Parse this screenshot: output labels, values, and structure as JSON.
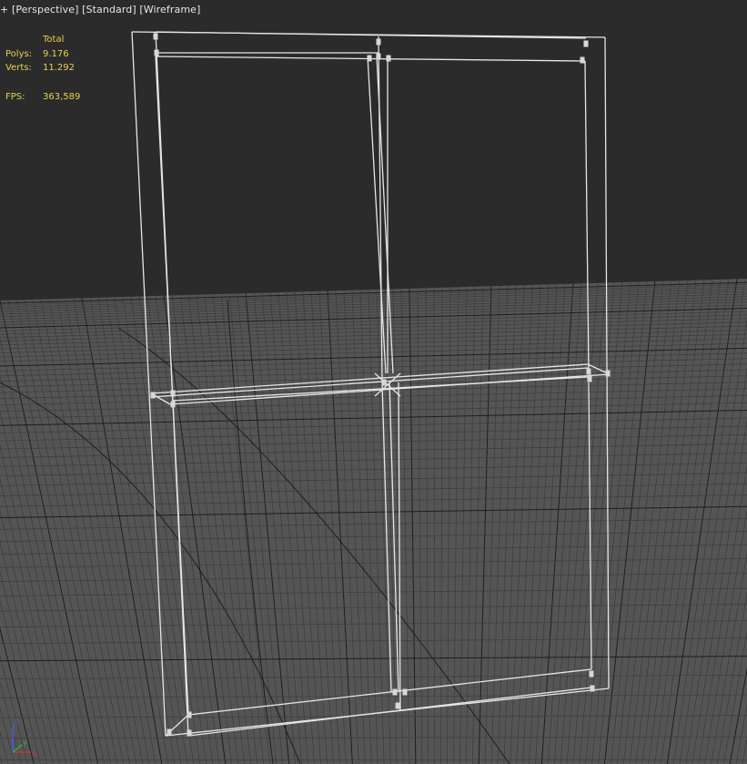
{
  "viewport": {
    "labels": [
      "+",
      "[Perspective]",
      "[Standard]",
      "[Wireframe]"
    ],
    "stats": {
      "header": "Total",
      "polys_label": "Polys:",
      "polys_value": "9.176",
      "verts_label": "Verts:",
      "verts_value": "11.292",
      "fps_label": "FPS:",
      "fps_value": "363,589"
    },
    "axis_gizmo": {
      "x": "x",
      "y": "y",
      "z": "z"
    }
  },
  "colors": {
    "background": "#2b2b2b",
    "floor": "#555555",
    "grid_line": "#3c3c3c",
    "grid_major": "#1e1e1e",
    "wire": "#e6e6e6",
    "stats_text": "#e8d24a",
    "axis_x": "#d03030",
    "axis_y": "#30b030",
    "axis_z": "#4060e0"
  }
}
